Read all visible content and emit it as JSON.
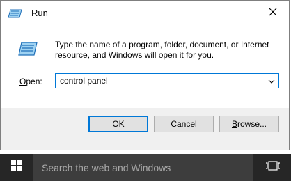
{
  "window": {
    "title": "Run",
    "description": "Type the name of a program, folder, document, or Internet resource, and Windows will open it for you.",
    "open_label": {
      "accel": "O",
      "rest": "pen:"
    },
    "open_value": "control panel",
    "icons": {
      "title": "run-icon",
      "close": "close-icon",
      "dropdown": "chevron-down-icon"
    },
    "buttons": {
      "ok": "OK",
      "cancel": "Cancel",
      "browse": {
        "accel": "B",
        "rest": "rowse..."
      }
    }
  },
  "taskbar": {
    "search_placeholder": "Search the web and Windows",
    "icons": {
      "start": "windows-logo-icon",
      "task_view": "task-view-icon"
    }
  },
  "colors": {
    "accent": "#0078d7",
    "taskbar": "#262626",
    "search_box": "#3d3d3d"
  }
}
